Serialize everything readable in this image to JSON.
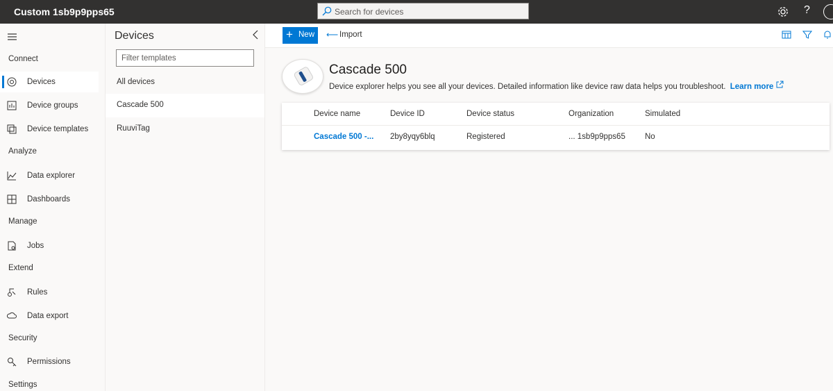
{
  "app": {
    "title": "Custom 1sb9p9pps65",
    "search_placeholder": "Search for devices",
    "help_label": "?"
  },
  "nav": {
    "sections": [
      {
        "label": "Connect"
      },
      {
        "label": "Analyze"
      },
      {
        "label": "Manage"
      },
      {
        "label": "Extend"
      },
      {
        "label": "Security"
      },
      {
        "label": "Settings"
      }
    ],
    "items": [
      {
        "label": "Devices",
        "icon": "devices-icon"
      },
      {
        "label": "Device groups",
        "icon": "device-groups-icon"
      },
      {
        "label": "Device templates",
        "icon": "device-templates-icon"
      },
      {
        "label": "Data explorer",
        "icon": "data-explorer-icon"
      },
      {
        "label": "Dashboards",
        "icon": "dashboards-icon"
      },
      {
        "label": "Jobs",
        "icon": "jobs-icon"
      },
      {
        "label": "Rules",
        "icon": "rules-icon"
      },
      {
        "label": "Data export",
        "icon": "data-export-icon"
      },
      {
        "label": "Permissions",
        "icon": "permissions-icon"
      }
    ]
  },
  "templates": {
    "title": "Devices",
    "filter_placeholder": "Filter templates",
    "items": [
      {
        "label": "All devices"
      },
      {
        "label": "Cascade 500"
      },
      {
        "label": "RuuviTag"
      }
    ]
  },
  "toolbar": {
    "new_label": "New",
    "import_label": "Import"
  },
  "main": {
    "title": "Cascade 500",
    "description": "Device explorer helps you see all your devices. Detailed information like device raw data helps you troubleshoot.",
    "learn_more": "Learn more",
    "columns": [
      "Device name",
      "Device ID",
      "Device status",
      "Organization",
      "Simulated"
    ],
    "rows": [
      {
        "name": "Cascade 500 -...",
        "id": "2by8yqy6blq",
        "status": "Registered",
        "organization": "... 1sb9p9pps65",
        "simulated": "No"
      }
    ]
  },
  "colors": {
    "accent": "#0078d4",
    "topbar": "#323130"
  }
}
